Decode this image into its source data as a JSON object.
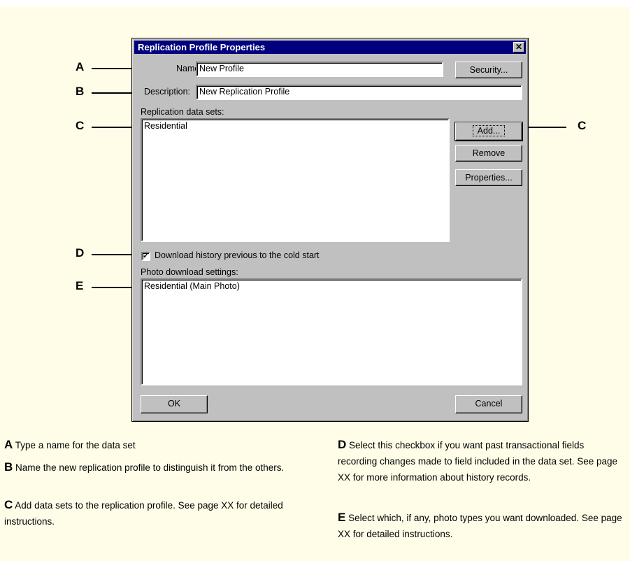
{
  "dialog": {
    "title": "Replication Profile Properties",
    "close_glyph": "✕",
    "name_label": "Name:",
    "name_value": "New Profile",
    "description_label": "Description:",
    "description_value": "New Replication Profile",
    "data_sets_label": "Replication data sets:",
    "data_sets_items": [
      "Residential"
    ],
    "security_button": "Security...",
    "add_button": "Add...",
    "remove_button": "Remove",
    "properties_button": "Properties...",
    "history_checkbox_checked": true,
    "history_checkbox_glyph": "✓",
    "history_checkbox_label": "Download history previous to the cold start",
    "photo_settings_label": "Photo download settings:",
    "photo_settings_items": [
      "Residential (Main Photo)"
    ],
    "ok_button": "OK",
    "cancel_button": "Cancel"
  },
  "callouts": {
    "a": "A",
    "b": "B",
    "c_left": "C",
    "c_right": "C",
    "d": "D",
    "e": "E"
  },
  "descriptions": {
    "a": {
      "letter": "A",
      "text": "Type a name for the data set"
    },
    "b": {
      "letter": "B",
      "text": "Name the new replication profile to distinguish it from the others."
    },
    "c": {
      "letter": "C",
      "text": "Add data sets to the replication profile. See page XX for detailed instructions."
    },
    "d": {
      "letter": "D",
      "text": "Select this checkbox if you want past transactional fields recording changes made to field included in the data set. See page XX for more information about history records."
    },
    "e": {
      "letter": "E",
      "text": "Select which, if any, photo types you want downloaded. See page XX for detailed instructions."
    }
  }
}
